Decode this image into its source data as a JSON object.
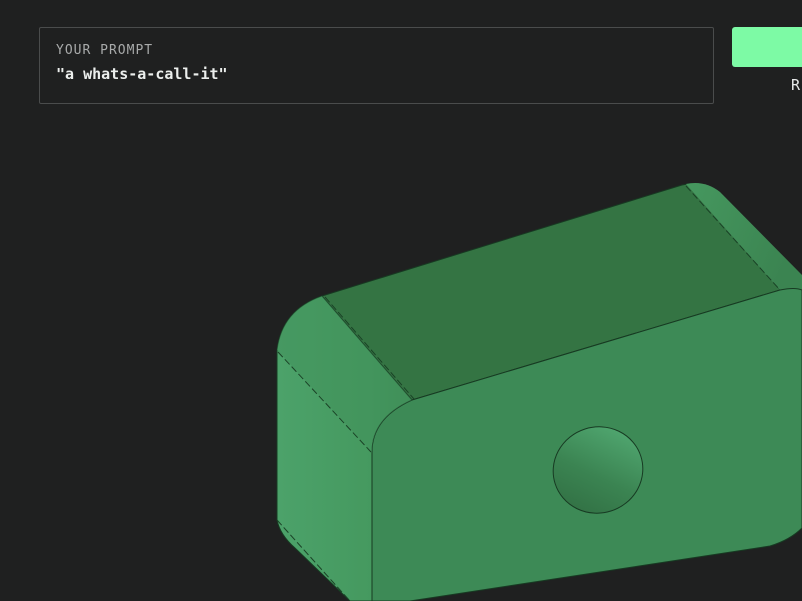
{
  "prompt": {
    "label": "YOUR PROMPT",
    "value": "\"a whats-a-call-it\""
  },
  "action": {
    "label": "",
    "caption": "R"
  },
  "viewport": {
    "model_color": "#3d8a56",
    "background": "#1f2020"
  }
}
